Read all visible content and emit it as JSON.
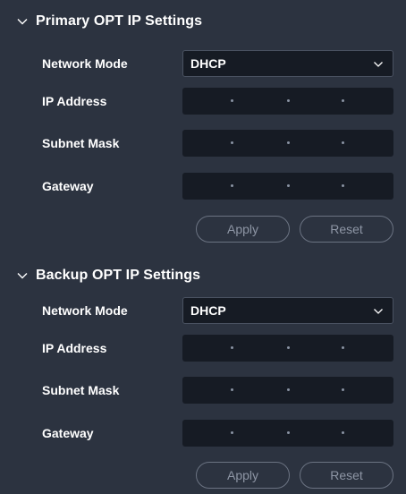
{
  "primary": {
    "title": "Primary OPT IP Settings",
    "network_mode_label": "Network Mode",
    "network_mode_value": "DHCP",
    "ip_address_label": "IP Address",
    "subnet_mask_label": "Subnet Mask",
    "gateway_label": "Gateway",
    "apply_label": "Apply",
    "reset_label": "Reset"
  },
  "backup": {
    "title": "Backup OPT IP Settings",
    "network_mode_label": "Network Mode",
    "network_mode_value": "DHCP",
    "ip_address_label": "IP Address",
    "subnet_mask_label": "Subnet Mask",
    "gateway_label": "Gateway",
    "apply_label": "Apply",
    "reset_label": "Reset"
  },
  "icons": {
    "section_toggle": "chevron-down-icon",
    "select_arrow": "chevron-down-icon"
  },
  "colors": {
    "background": "#2c3340",
    "field_background": "#161b24",
    "button_border": "#6b7382",
    "button_text": "#8e96a5"
  }
}
